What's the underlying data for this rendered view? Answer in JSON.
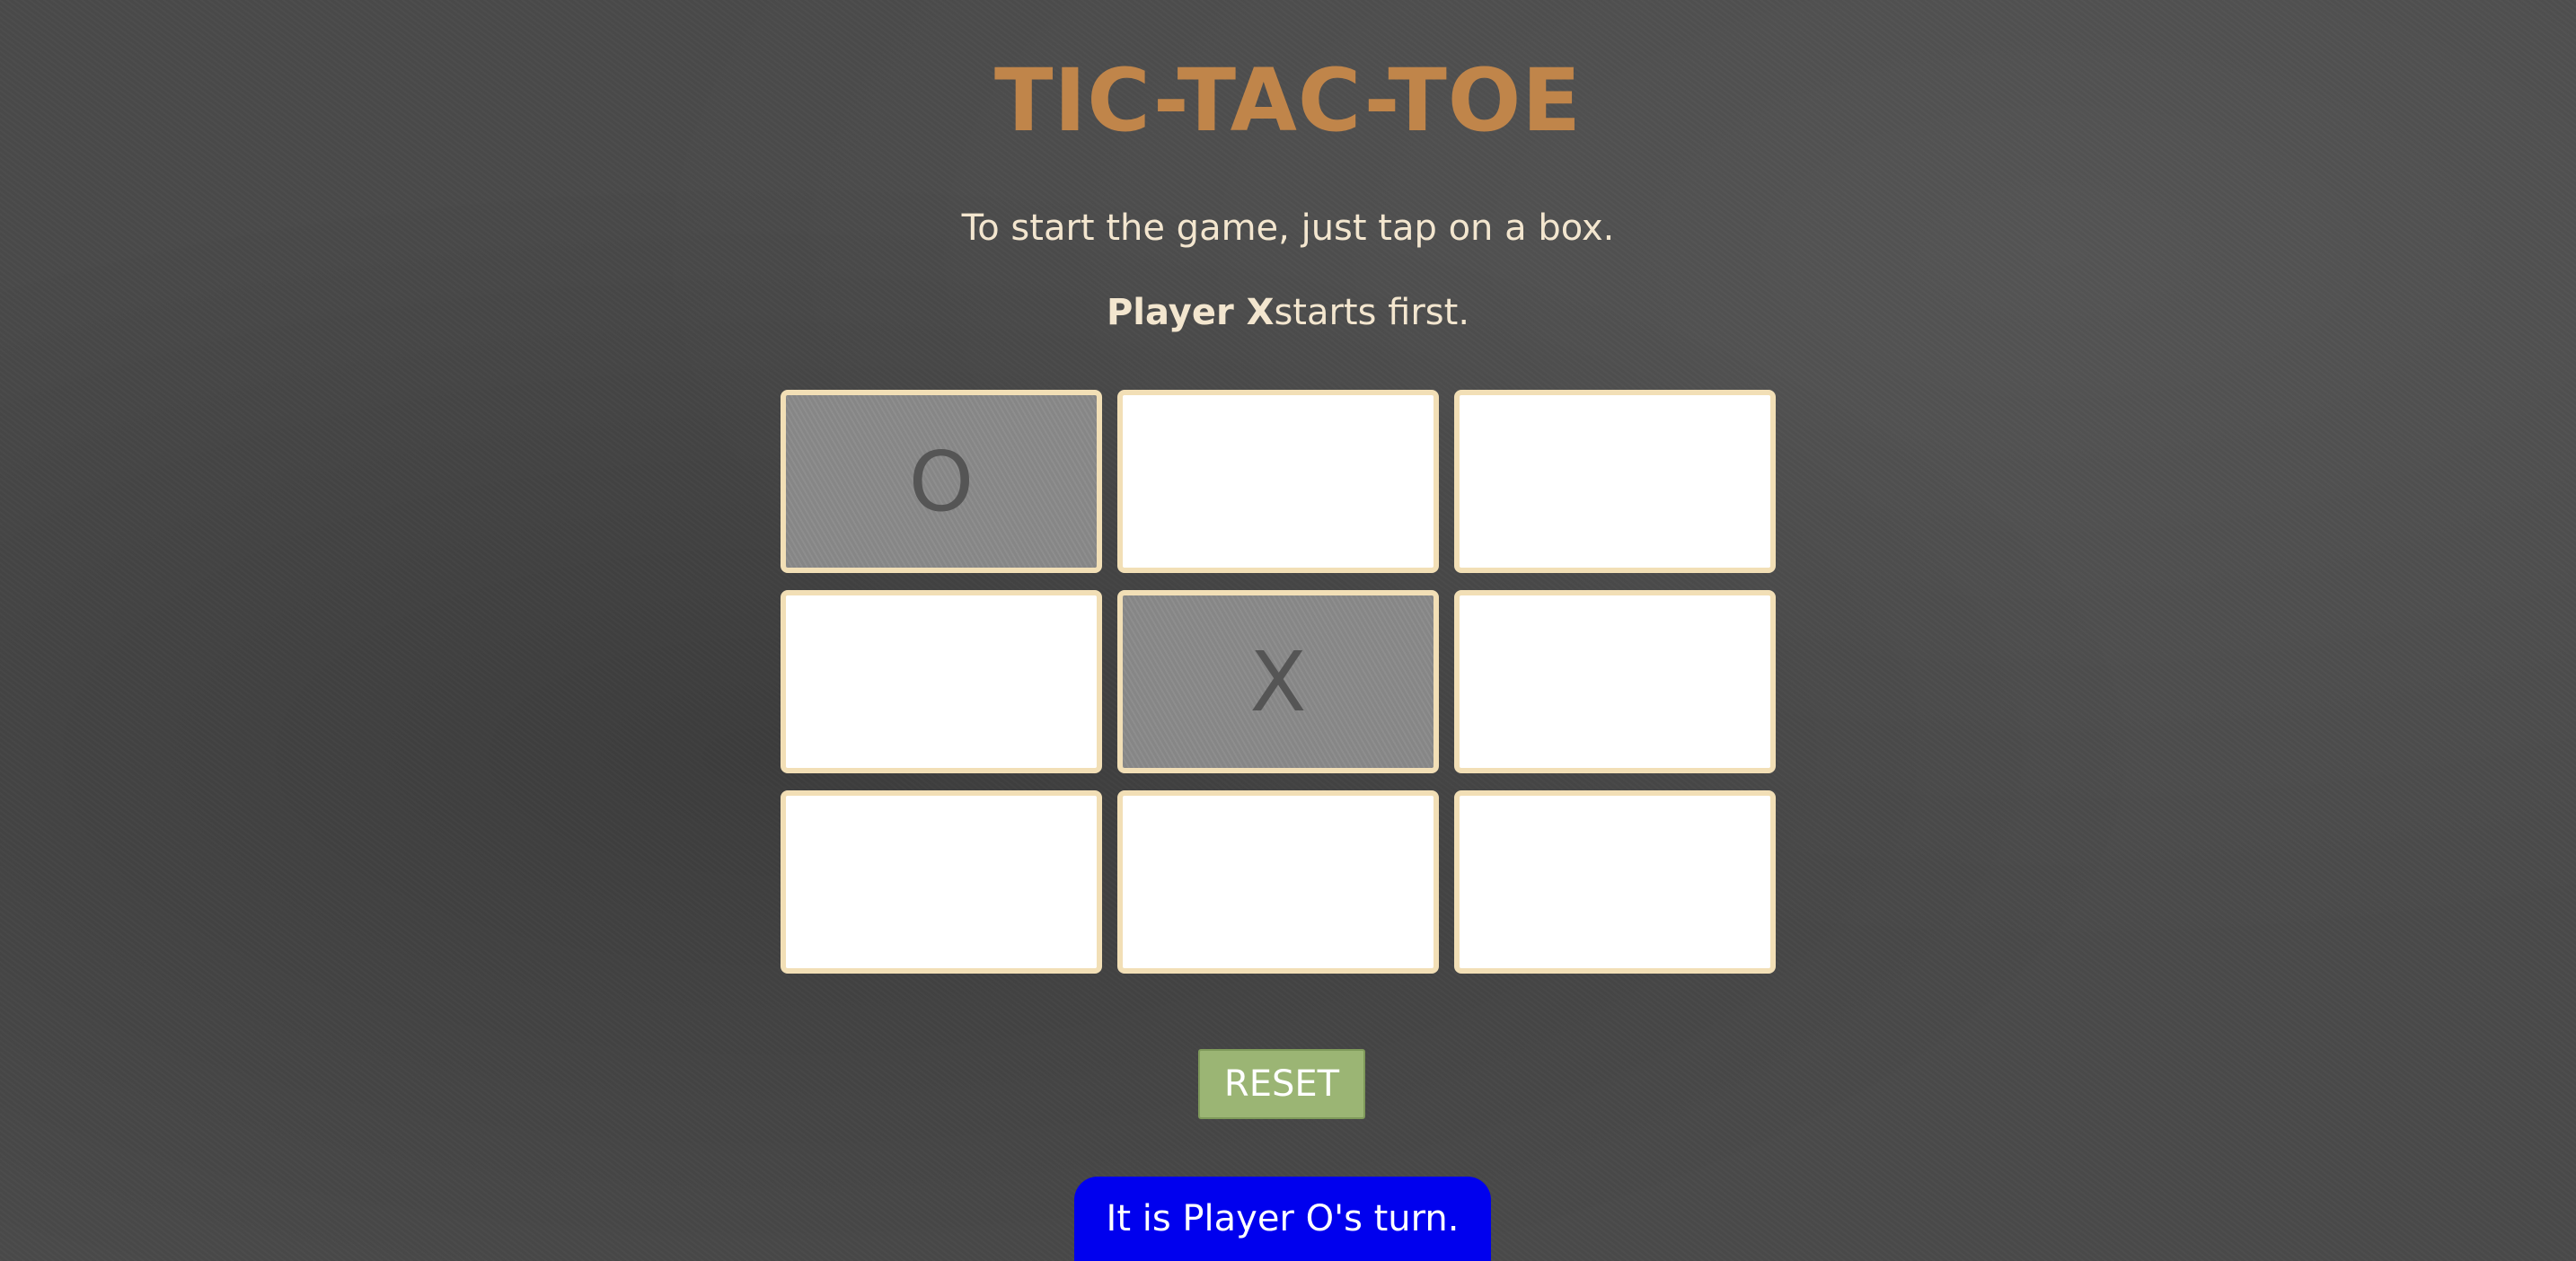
{
  "title": "TIC-TAC-TOE",
  "instruction": "To start the game, just tap on a box.",
  "first_player": {
    "name": "Player X",
    "suffix": "starts first."
  },
  "board": {
    "cells": [
      "O",
      "",
      "",
      "",
      "X",
      "",
      "",
      "",
      ""
    ]
  },
  "reset_label": "RESET",
  "status": "It is Player O's turn.",
  "colors": {
    "title": "#c0854a",
    "text": "#f3e6cf",
    "cell_border": "#f2dfb6",
    "cell_empty": "#ffffff",
    "cell_filled": "#8a8a8a",
    "reset_button": "#9bb574",
    "status_bg": "#0000ee"
  }
}
